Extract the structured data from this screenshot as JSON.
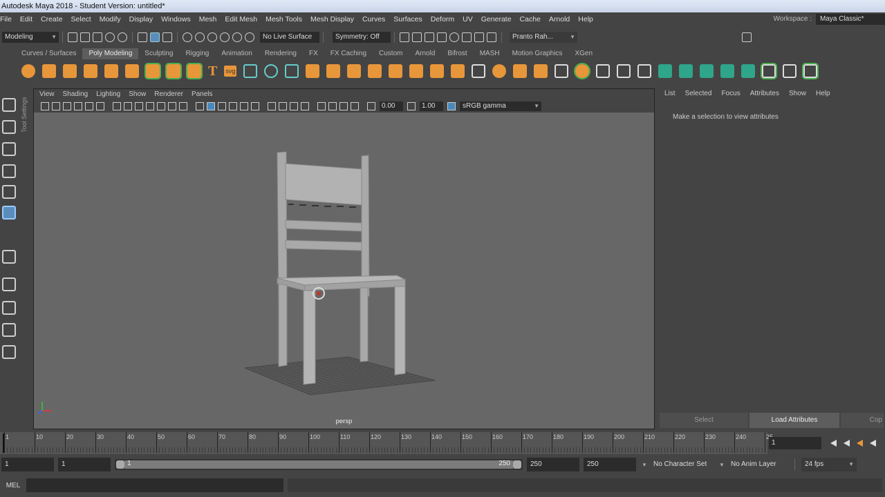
{
  "window": {
    "title": "Autodesk Maya 2018 - Student Version: untitled*"
  },
  "menubar": {
    "items": [
      "File",
      "Edit",
      "Create",
      "Select",
      "Modify",
      "Display",
      "Windows",
      "Mesh",
      "Edit Mesh",
      "Mesh Tools",
      "Mesh Display",
      "Curves",
      "Surfaces",
      "Deform",
      "UV",
      "Generate",
      "Cache",
      "Arnold",
      "Help"
    ],
    "workspace_label": "Workspace :",
    "workspace_value": "Maya Classic*"
  },
  "statusline": {
    "mode": "Modeling",
    "live_surface": "No Live Surface",
    "symmetry": "Symmetry: Off",
    "user": "Pranto Rah..."
  },
  "shelf": {
    "tabs": [
      "Curves / Surfaces",
      "Poly Modeling",
      "Sculpting",
      "Rigging",
      "Animation",
      "Rendering",
      "FX",
      "FX Caching",
      "Custom",
      "Arnold",
      "Bifrost",
      "MASH",
      "Motion Graphics",
      "XGen"
    ],
    "active_tab": "Poly Modeling",
    "text_tool": "T",
    "svg_tool": "svg"
  },
  "toolbox": {
    "tool_settings_label": "Tool Settings",
    "logo": "M"
  },
  "viewport": {
    "menu": [
      "View",
      "Shading",
      "Lighting",
      "Show",
      "Renderer",
      "Panels"
    ],
    "exposure": "0.00",
    "gamma": "1.00",
    "color_space": "sRGB gamma",
    "camera_label": "persp"
  },
  "attribute_editor": {
    "menu": [
      "List",
      "Selected",
      "Focus",
      "Attributes",
      "Show",
      "Help"
    ],
    "message": "Make a selection to view attributes",
    "select_button": "Select",
    "load_button": "Load Attributes",
    "copy_button": "Cop"
  },
  "timeline": {
    "tick_labels": [
      "1",
      "10",
      "20",
      "30",
      "40",
      "50",
      "60",
      "70",
      "80",
      "90",
      "100",
      "110",
      "120",
      "130",
      "140",
      "150",
      "160",
      "170",
      "180",
      "190",
      "200",
      "210",
      "220",
      "230",
      "240",
      "25"
    ],
    "current_frame": "1"
  },
  "range": {
    "start": "1",
    "playback_start": "1",
    "slider_start": "1",
    "slider_end": "250",
    "playback_end": "250",
    "end": "250",
    "character_set": "No Character Set",
    "anim_layer": "No Anim Layer",
    "fps": "24 fps"
  },
  "command_line": {
    "label": "MEL"
  },
  "colors": {
    "accent": "#e8963a",
    "selection": "#5a8dbb",
    "viewport_bg": "#676767"
  }
}
